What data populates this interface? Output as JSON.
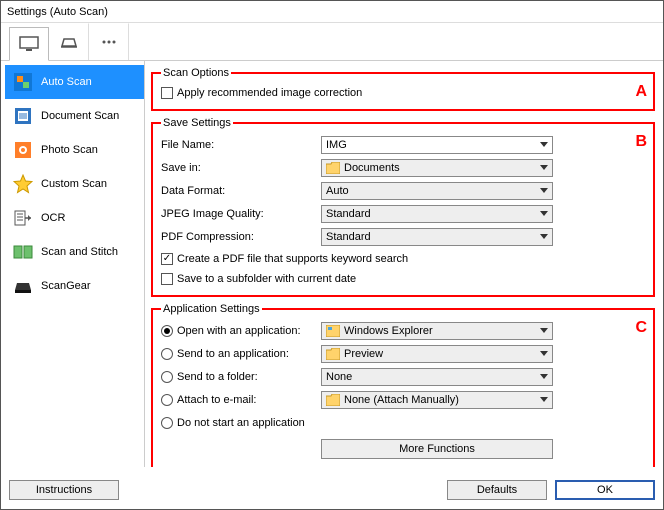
{
  "window": {
    "title": "Settings (Auto Scan)"
  },
  "sidebar": {
    "items": [
      {
        "label": "Auto Scan"
      },
      {
        "label": "Document Scan"
      },
      {
        "label": "Photo Scan"
      },
      {
        "label": "Custom Scan"
      },
      {
        "label": "OCR"
      },
      {
        "label": "Scan and Stitch"
      },
      {
        "label": "ScanGear"
      }
    ]
  },
  "groups": {
    "scanOptions": {
      "legend": "Scan Options",
      "annot": "A",
      "applyCorrection": "Apply recommended image correction"
    },
    "saveSettings": {
      "legend": "Save Settings",
      "annot": "B",
      "fileNameLabel": "File Name:",
      "fileNameValue": "IMG",
      "saveInLabel": "Save in:",
      "saveInValue": "Documents",
      "dataFormatLabel": "Data Format:",
      "dataFormatValue": "Auto",
      "jpegQualityLabel": "JPEG Image Quality:",
      "jpegQualityValue": "Standard",
      "pdfCompressionLabel": "PDF Compression:",
      "pdfCompressionValue": "Standard",
      "createPdf": "Create a PDF file that supports keyword search",
      "saveSubfolder": "Save to a subfolder with current date"
    },
    "appSettings": {
      "legend": "Application Settings",
      "annot": "C",
      "openWithLabel": "Open with an application:",
      "openWithValue": "Windows Explorer",
      "sendAppLabel": "Send to an application:",
      "sendAppValue": "Preview",
      "sendFolderLabel": "Send to a folder:",
      "sendFolderValue": "None",
      "attachEmailLabel": "Attach to e-mail:",
      "attachEmailValue": "None (Attach Manually)",
      "doNotStart": "Do not start an application",
      "moreFunctions": "More Functions"
    }
  },
  "buttons": {
    "instructions": "Instructions",
    "defaults": "Defaults",
    "ok": "OK"
  }
}
